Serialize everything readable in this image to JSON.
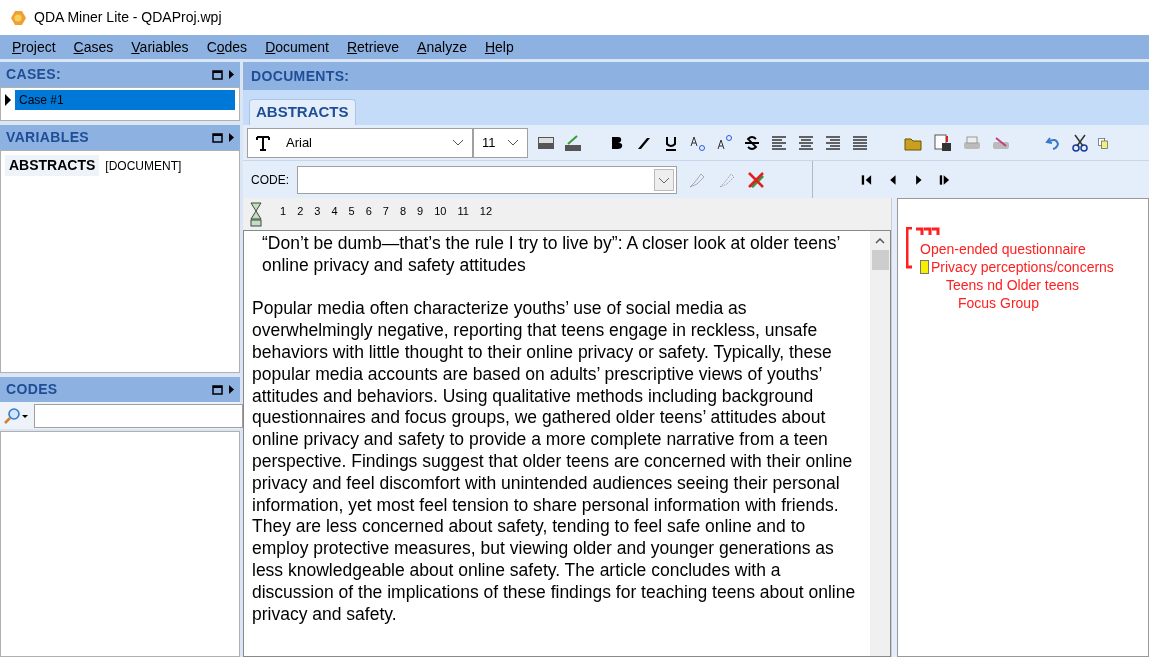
{
  "window": {
    "title": "QDA Miner Lite - QDAProj.wpj"
  },
  "menu": [
    {
      "key": "P",
      "post": "roject"
    },
    {
      "key": "C",
      "post": "ases"
    },
    {
      "key": "V",
      "post": "ariables"
    },
    {
      "pre": "C",
      "key": "o",
      "post": "des"
    },
    {
      "key": "D",
      "post": "ocument"
    },
    {
      "key": "R",
      "post": "etrieve"
    },
    {
      "key": "A",
      "post": "nalyze"
    },
    {
      "key": "H",
      "post": "elp"
    }
  ],
  "cases": {
    "title": "CASES:",
    "items": [
      {
        "label": "Case #1",
        "selected": true
      }
    ]
  },
  "variables": {
    "title": "VARIABLES",
    "items": [
      {
        "name": "ABSTRACTS",
        "type": "[DOCUMENT]"
      }
    ]
  },
  "codes": {
    "title": "CODES"
  },
  "documents": {
    "title": "DOCUMENTS:",
    "tabs": [
      {
        "label": "ABSTRACTS",
        "selected": true
      }
    ],
    "font": "Arial",
    "size": "11",
    "code_label": "CODE:",
    "ruler": [
      "1",
      "2",
      "3",
      "4",
      "5",
      "6",
      "7",
      "8",
      "9",
      "10",
      "11",
      "12"
    ],
    "doc_title": "“Don’t be dumb—that’s the rule I try to live by”: A closer look at older teens’ online privacy and safety attitudes",
    "body": "Popular media often characterize youths’ use of social media as overwhelmingly negative, reporting that teens engage in reckless, unsafe behaviors with little thought to their online privacy or safety. Typically, these popular media accounts are based on adults’ prescriptive views of youths’ attitudes and behaviors. Using qualitative methods including background questionnaires and focus groups, we gathered older teens’ attitudes about online privacy and safety to provide a more complete narrative from a teen perspective. Findings suggest that older teens are concerned with their online privacy and feel discomfort with unintended audiences seeing their personal information, yet most feel tension to share personal information with friends. They are less concerned about safety, tending to feel safe online and to employ protective measures, but viewing older and younger generations as less knowledgeable about online safety. The article concludes with a discussion of the implications of these findings for teaching teens about online privacy and safety.",
    "codings": [
      {
        "label": "Open-ended questionnaire",
        "memo": false
      },
      {
        "label": "Privacy perceptions/concerns",
        "memo": true
      },
      {
        "label": "Teens nd Older teens",
        "memo": false
      },
      {
        "label": "Focus Group",
        "memo": false
      }
    ]
  }
}
